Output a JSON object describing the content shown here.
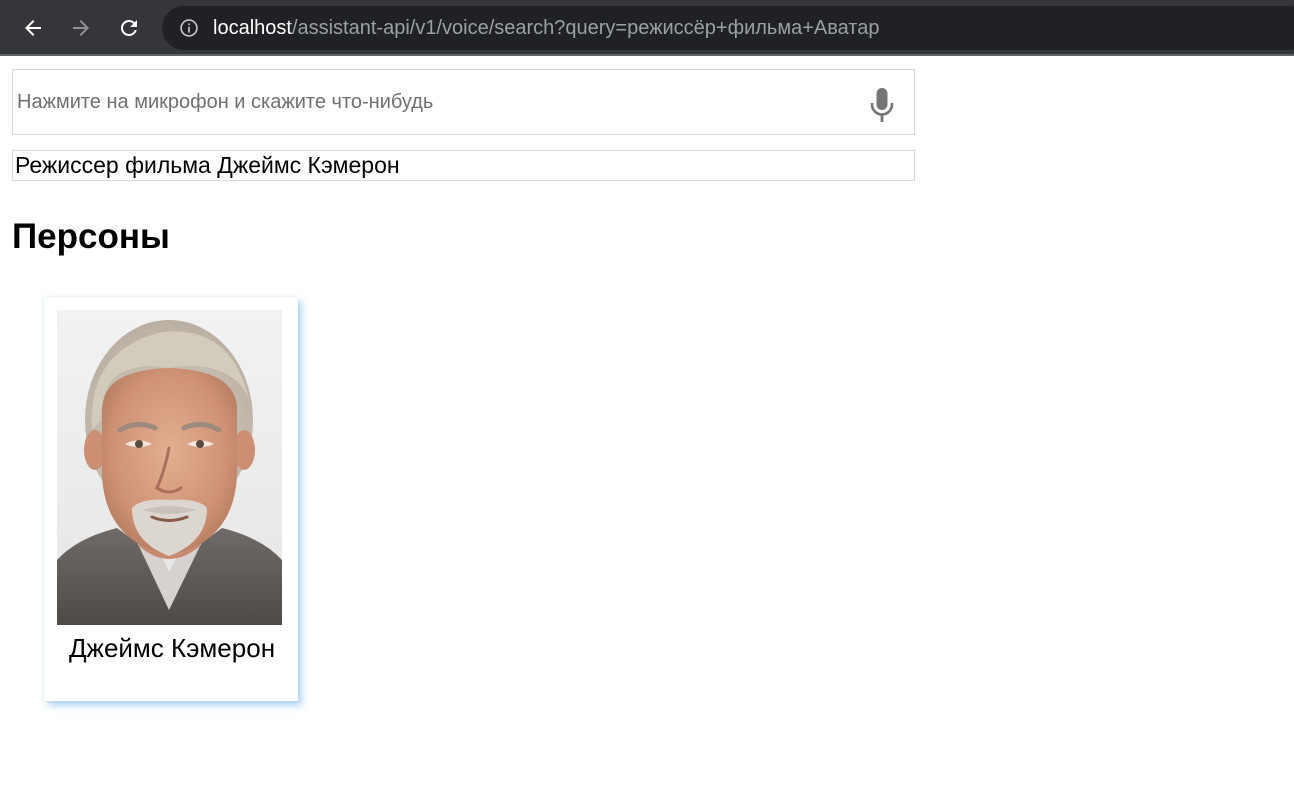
{
  "browser": {
    "url_host": "localhost",
    "url_path": "/assistant-api/v1/voice/search?query=режиссёр+фильма+Аватар"
  },
  "search": {
    "placeholder": "Нажмите на микрофон и скажите что-нибудь",
    "value": "",
    "mic_icon": "microphone-icon"
  },
  "result": {
    "text": "Режиссер фильма Джеймс Кэмерон"
  },
  "persons_section": {
    "heading": "Персоны",
    "items": [
      {
        "name": "Джеймс Кэмерон",
        "photo": "portrait-photo"
      }
    ]
  },
  "colors": {
    "browser_bar": "#35363a",
    "address_bar": "#202124",
    "card_shadow": "#78b4eb",
    "mic_icon": "#757575"
  }
}
